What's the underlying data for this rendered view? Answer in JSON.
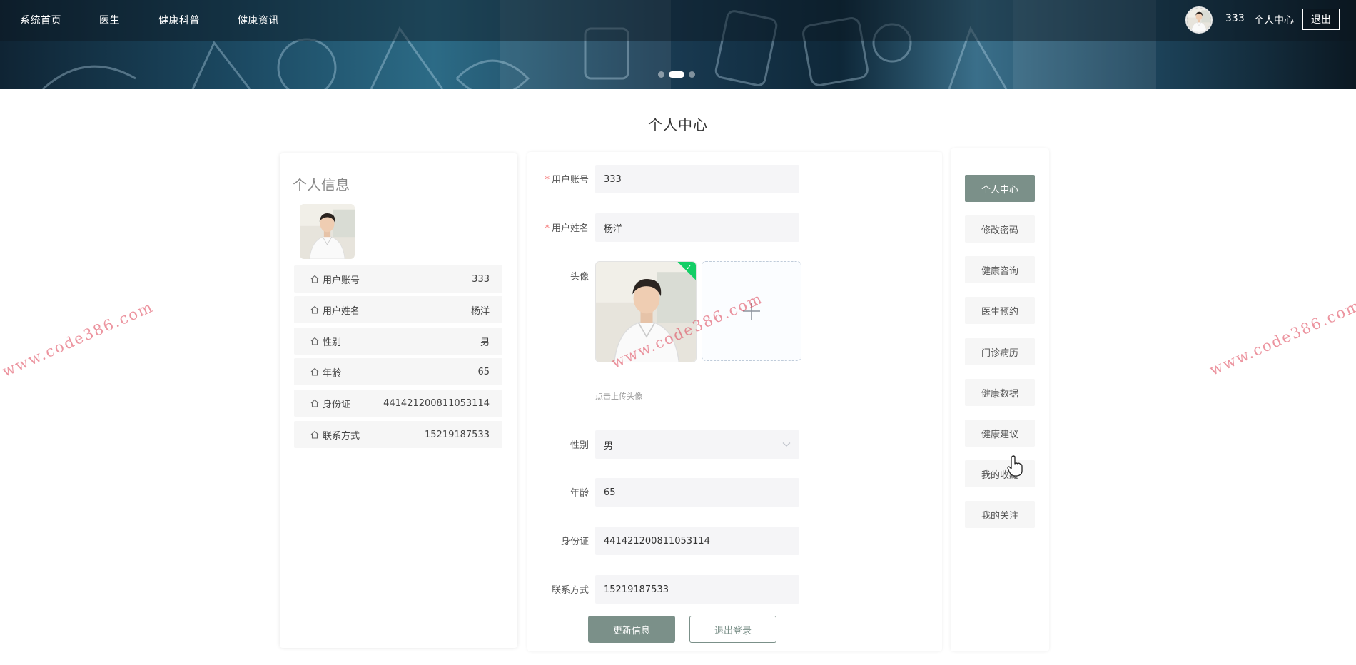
{
  "nav": {
    "items": [
      "系统首页",
      "医生",
      "健康科普",
      "健康资讯"
    ],
    "username": "333",
    "user_center": "个人中心",
    "logout": "退出"
  },
  "page_title": "个人中心",
  "profile_card": {
    "title": "个人信息",
    "rows": [
      {
        "label": "用户账号",
        "value": "333"
      },
      {
        "label": "用户姓名",
        "value": "杨洋"
      },
      {
        "label": "性别",
        "value": "男"
      },
      {
        "label": "年龄",
        "value": "65"
      },
      {
        "label": "身份证",
        "value": "441421200811053114"
      },
      {
        "label": "联系方式",
        "value": "15219187533"
      }
    ]
  },
  "form": {
    "account_label": "用户账号",
    "account_value": "333",
    "name_label": "用户姓名",
    "name_value": "杨洋",
    "avatar_label": "头像",
    "avatar_hint": "点击上传头像",
    "gender_label": "性别",
    "gender_value": "男",
    "age_label": "年龄",
    "age_value": "65",
    "id_label": "身份证",
    "id_value": "441421200811053114",
    "phone_label": "联系方式",
    "phone_value": "15219187533",
    "update_button": "更新信息",
    "logout_button": "退出登录"
  },
  "menu": {
    "items": [
      "个人中心",
      "修改密码",
      "健康咨询",
      "医生预约",
      "门诊病历",
      "健康数据",
      "健康建议",
      "我的收藏",
      "我的关注"
    ],
    "active_index": 0
  },
  "watermark": "www.code386.com",
  "colors": {
    "accent": "#7b9089",
    "upload_success": "#13ce66",
    "required": "#f56c6c",
    "watermark": "#dc3c50"
  },
  "icons": {
    "row_icon": "home-icon",
    "upload_add": "plus-icon",
    "select": "chevron-down-icon",
    "upload_ok": "check-icon"
  }
}
